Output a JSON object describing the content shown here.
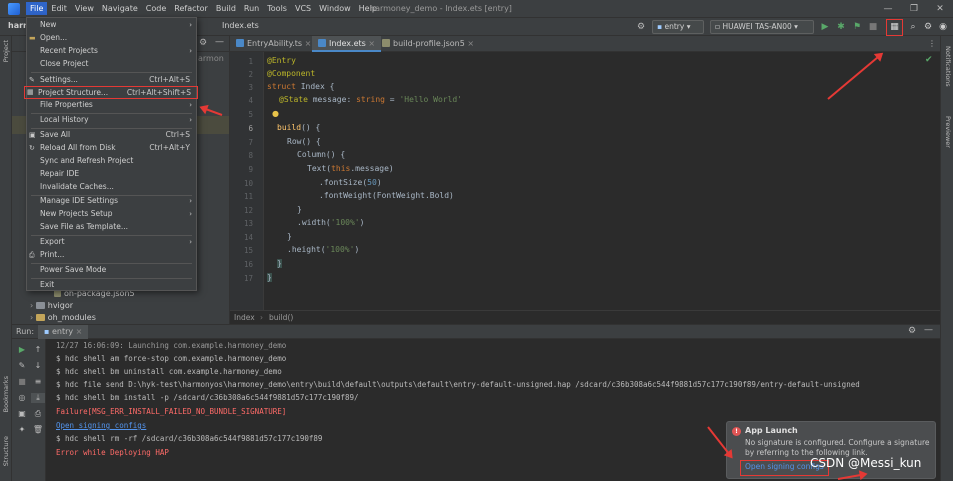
{
  "window": {
    "title": "harmoney_demo - Index.ets [entry]",
    "menu": [
      "File",
      "Edit",
      "View",
      "Navigate",
      "Code",
      "Refactor",
      "Build",
      "Run",
      "Tools",
      "VCS",
      "Window",
      "Help"
    ],
    "active_menu": "File"
  },
  "navbar": {
    "project": "harm",
    "file": "Index.ets",
    "module_select": "entry",
    "device_select": "HUAWEI TAS-AN00"
  },
  "left_strip": {
    "project_tab": "Project",
    "bookmarks_tab": "Bookmarks",
    "structure_tab": "Structure"
  },
  "right_strip": {
    "notifications_tab": "Notifications",
    "previewer_tab": "Previewer"
  },
  "project_tree": {
    "visible_suffix": "armon",
    "rows": [
      {
        "label": "oh-package.json5",
        "type": "file"
      },
      {
        "label": "hvigor",
        "type": "folder"
      },
      {
        "label": "oh_modules",
        "type": "folder"
      }
    ]
  },
  "file_menu": {
    "items": [
      {
        "label": "New",
        "shortcut": "",
        "submenu": true,
        "icon": ""
      },
      {
        "label": "Open...",
        "shortcut": "",
        "submenu": false,
        "icon": "folder-icon"
      },
      {
        "label": "Recent Projects",
        "shortcut": "",
        "submenu": true,
        "icon": ""
      },
      {
        "label": "Close Project",
        "shortcut": "",
        "submenu": false,
        "icon": ""
      },
      {
        "label": "Settings...",
        "shortcut": "Ctrl+Alt+S",
        "submenu": false,
        "icon": "wrench-icon"
      },
      {
        "label": "Project Structure...",
        "shortcut": "Ctrl+Alt+Shift+S",
        "submenu": false,
        "icon": "project-structure-icon",
        "highlighted": true
      },
      {
        "label": "File Properties",
        "shortcut": "",
        "submenu": true,
        "icon": ""
      },
      {
        "label": "Local History",
        "shortcut": "",
        "submenu": true,
        "icon": ""
      },
      {
        "label": "Save All",
        "shortcut": "Ctrl+S",
        "submenu": false,
        "icon": "save-icon"
      },
      {
        "label": "Reload All from Disk",
        "shortcut": "Ctrl+Alt+Y",
        "submenu": false,
        "icon": "reload-icon"
      },
      {
        "label": "Sync and Refresh Project",
        "shortcut": "",
        "submenu": false,
        "icon": ""
      },
      {
        "label": "Repair IDE",
        "shortcut": "",
        "submenu": false,
        "icon": ""
      },
      {
        "label": "Invalidate Caches...",
        "shortcut": "",
        "submenu": false,
        "icon": ""
      },
      {
        "label": "Manage IDE Settings",
        "shortcut": "",
        "submenu": true,
        "icon": ""
      },
      {
        "label": "New Projects Setup",
        "shortcut": "",
        "submenu": true,
        "icon": ""
      },
      {
        "label": "Save File as Template...",
        "shortcut": "",
        "submenu": false,
        "icon": ""
      },
      {
        "label": "Export",
        "shortcut": "",
        "submenu": true,
        "icon": ""
      },
      {
        "label": "Print...",
        "shortcut": "",
        "submenu": false,
        "icon": "print-icon"
      },
      {
        "label": "Power Save Mode",
        "shortcut": "",
        "submenu": false,
        "icon": ""
      },
      {
        "label": "Exit",
        "shortcut": "",
        "submenu": false,
        "icon": ""
      }
    ]
  },
  "editor": {
    "tabs": [
      {
        "label": "EntryAbility.ts",
        "active": false
      },
      {
        "label": "Index.ets",
        "active": true
      },
      {
        "label": "build-profile.json5",
        "active": false
      }
    ],
    "line_numbers": [
      "1",
      "2",
      "3",
      "4",
      "5",
      "6",
      "7",
      "8",
      "9",
      "10",
      "11",
      "12",
      "13",
      "14",
      "15",
      "16",
      "17"
    ],
    "code": {
      "l1": "@Entry",
      "l2": "@Component",
      "l3_kw": "struct",
      "l3_name": " Index {",
      "l4_dec": "@State",
      "l4_rest": " message: ",
      "l4_type": "string",
      "l4_eq": " = ",
      "l4_str": "'Hello World'",
      "l6_fn": "build",
      "l6_rest": "() {",
      "l7": "Row() {",
      "l8": "Column() {",
      "l9_a": "Text(",
      "l9_b": "this",
      "l9_c": ".message)",
      "l10_a": ".fontSize(",
      "l10_num": "50",
      "l10_b": ")",
      "l11": ".fontWeight(FontWeight.Bold)",
      "l12": "}",
      "l13_a": ".width(",
      "l13_str": "'100%'",
      "l13_b": ")",
      "l14": "}",
      "l15_a": ".height(",
      "l15_str": "'100%'",
      "l15_b": ")",
      "l16": "}",
      "l17": "}"
    },
    "breadcrumb": [
      "Index",
      "build()"
    ]
  },
  "run_panel": {
    "label": "Run:",
    "config": "entry",
    "lines": [
      {
        "text": "12/27 16:06:09: Launching com.example.harmoney_demo",
        "kind": "normal"
      },
      {
        "text": "$ hdc shell am force-stop com.example.harmoney_demo",
        "kind": "normal"
      },
      {
        "text": "$ hdc shell bm uninstall com.example.harmoney_demo",
        "kind": "normal"
      },
      {
        "text": "$ hdc file send D:\\hyk-test\\harmonyos\\harmoney_demo\\entry\\build\\default\\outputs\\default\\entry-default-unsigned.hap /sdcard/c36b308a6c544f9881d57c177c190f89/entry-default-unsigned",
        "kind": "normal"
      },
      {
        "text": "$ hdc shell bm install -p /sdcard/c36b308a6c544f9881d57c177c190f89/",
        "kind": "normal"
      },
      {
        "text": "Failure[MSG_ERR_INSTALL_FAILED_NO_BUNDLE_SIGNATURE]",
        "kind": "err"
      },
      {
        "text": "Open signing configs",
        "kind": "link"
      },
      {
        "text": "$ hdc shell rm -rf /sdcard/c36b308a6c544f9881d57c177c190f89",
        "kind": "normal"
      },
      {
        "text": "Error while Deploying HAP",
        "kind": "err"
      }
    ]
  },
  "notification": {
    "title": "App Launch",
    "body": "No signature is configured. Configure a signature by referring to the following link.",
    "link": "Open signing configs"
  },
  "watermark": "CSDN @Messi_kun",
  "colors": {
    "accent": "#2f65ca",
    "annotation": "#e53935",
    "error": "#ff6b68",
    "link": "#5394ec"
  }
}
